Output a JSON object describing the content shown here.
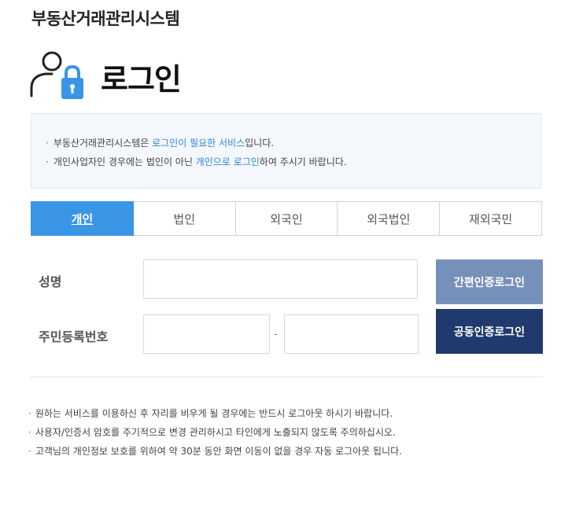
{
  "app": {
    "title": "부동산거래관리시스템"
  },
  "login": {
    "title": "로그인"
  },
  "info": {
    "line1": {
      "prefix": "부동산거래관리시스템은 ",
      "highlight": "로그인이 필요한 서비스",
      "suffix": "입니다."
    },
    "line2": {
      "prefix": "개인사업자인 경우에는 법인이 아닌 ",
      "highlight": "개인으로 로그인",
      "suffix": "하여 주시기 바랍니다."
    }
  },
  "tabs": [
    {
      "label": "개인",
      "active": true
    },
    {
      "label": "법인"
    },
    {
      "label": "외국인"
    },
    {
      "label": "외국법인"
    },
    {
      "label": "재외국민"
    }
  ],
  "form": {
    "name_label": "성명",
    "rrn_label": "주민등록번호",
    "rrn_separator": "-",
    "name_value": "",
    "rrn_front_value": "",
    "rrn_back_value": ""
  },
  "buttons": {
    "simple_cert": "간편인증로그인",
    "public_cert": "공동인증로그인"
  },
  "notes": [
    "원하는 서비스를 이용하신 후 자리를 비우게 될 경우에는 반드시 로그아웃 하시기 바랍니다.",
    "사용자/인증서 암호를 주기적으로 변경 관리하시고 타인에게 노출되지 않도록 주의하십시오.",
    "고객님의 개인정보 보호를 위하여 약 30분 동안 화면 이동이 없을 경우 자동 로그아웃 됩니다."
  ],
  "colors": {
    "accent": "#3a95e6",
    "highlight_text": "#2e87d8",
    "simple_button": "#7790b9",
    "cert_button": "#213a6e"
  },
  "icons": {
    "login": "user-lock-icon"
  }
}
